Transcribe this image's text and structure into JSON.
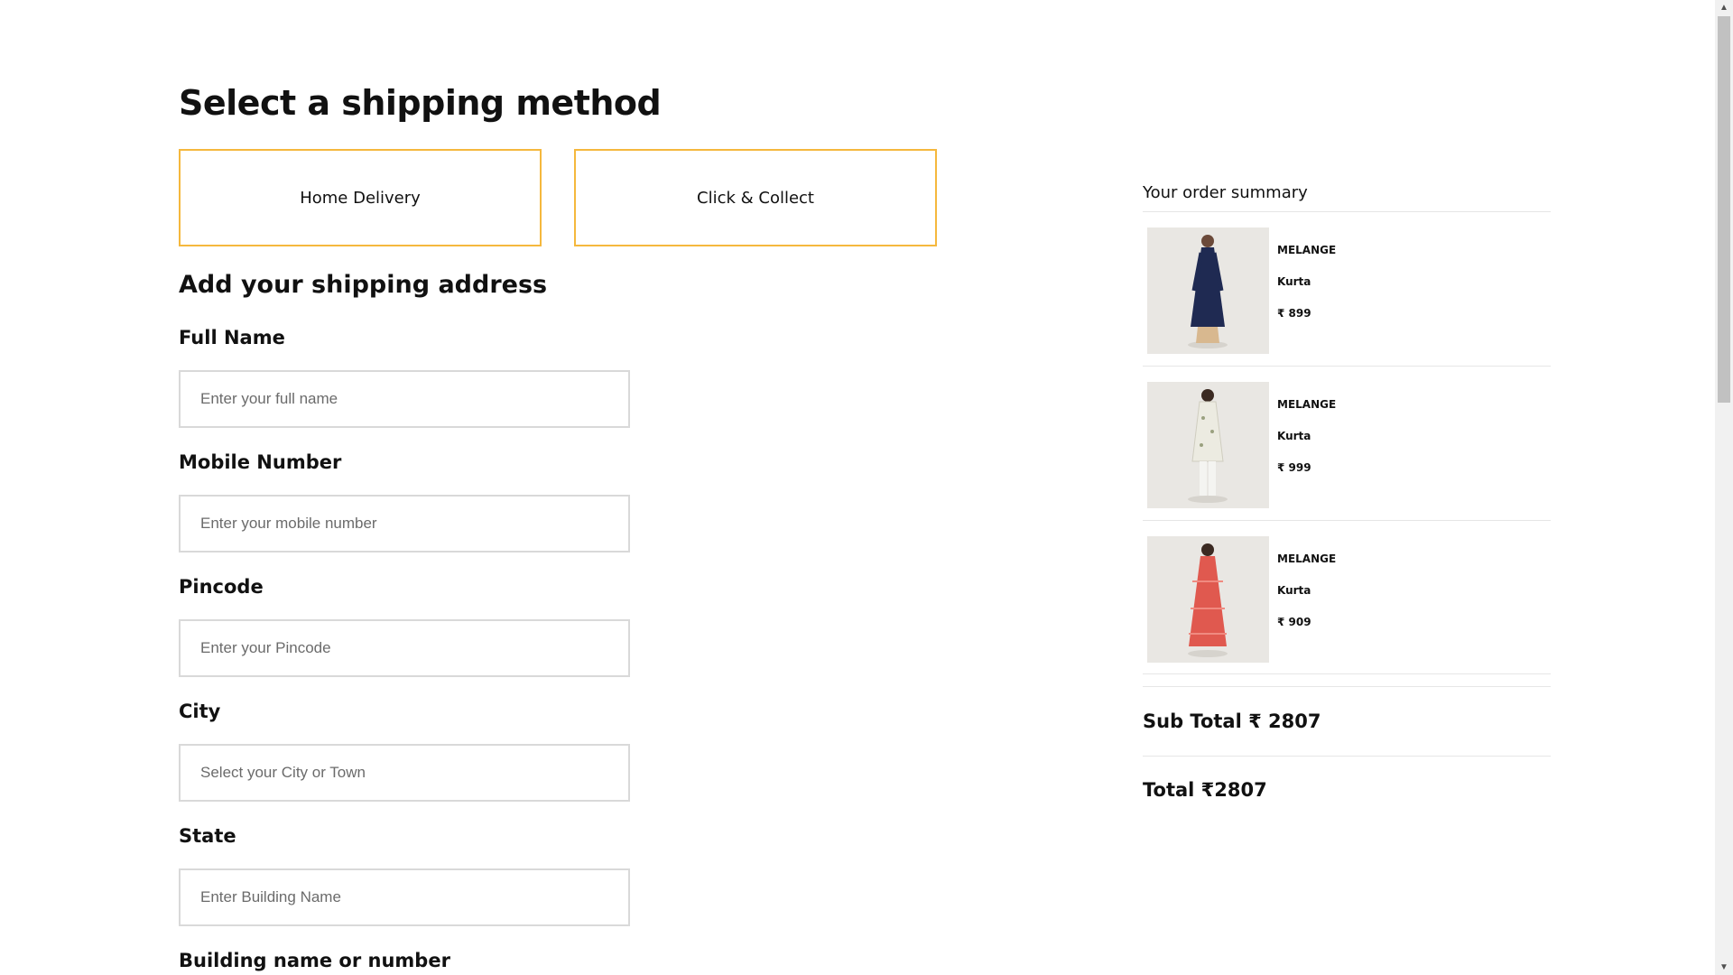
{
  "shipping": {
    "title": "Select a shipping method",
    "methods": [
      {
        "label": "Home Delivery"
      },
      {
        "label": "Click & Collect"
      }
    ]
  },
  "address": {
    "title": "Add your shipping address",
    "fields": [
      {
        "label": "Full Name",
        "placeholder": "Enter your full name"
      },
      {
        "label": "Mobile Number",
        "placeholder": "Enter your mobile number"
      },
      {
        "label": "Pincode",
        "placeholder": "Enter your Pincode"
      },
      {
        "label": "City",
        "placeholder": "Select your City or Town"
      },
      {
        "label": "State",
        "placeholder": "Enter Building Name"
      },
      {
        "label": "Building name or number"
      }
    ]
  },
  "summary": {
    "title": "Your order summary",
    "items": [
      {
        "brand": "MELANGE",
        "name": "Kurta",
        "price": "₹ 899"
      },
      {
        "brand": "MELANGE",
        "name": "Kurta",
        "price": "₹ 999"
      },
      {
        "brand": "MELANGE",
        "name": "Kurta",
        "price": "₹ 909"
      }
    ],
    "subtotal": "Sub Total ₹ 2807",
    "total": "Total ₹2807"
  },
  "colors": {
    "method_border": "#f5b83d",
    "kurta_1": "#1f2a52",
    "kurta_2": "#ecebe1",
    "kurta_3": "#e0594f"
  },
  "icons": {
    "scroll_up": "caret-up-icon",
    "scroll_down": "caret-down-icon"
  }
}
